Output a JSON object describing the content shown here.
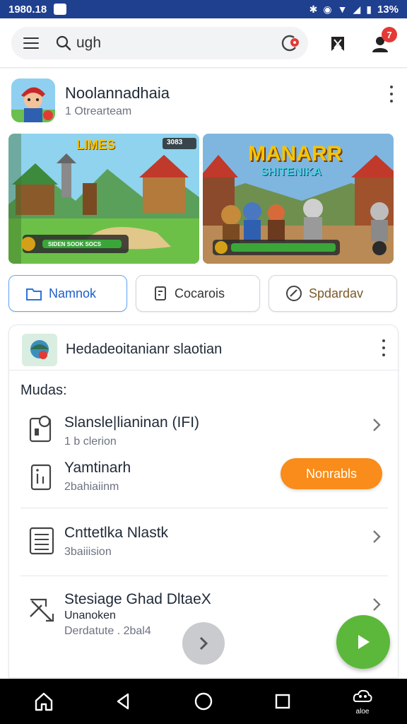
{
  "status_bar": {
    "time": "1980.18",
    "battery": "13%"
  },
  "search": {
    "query": "ugh",
    "notification_count": "7"
  },
  "app": {
    "title": "Noolannadhaia",
    "subtitle": "1 Otrearteam"
  },
  "screenshots": [
    {
      "label": "LIMES",
      "score": "3083",
      "bar_text": "SIDEN SOOK SOCS"
    },
    {
      "label": "MANARR",
      "sub_label": "SHITENIKA"
    }
  ],
  "chips": [
    {
      "label": "Namnok",
      "icon": "bag-icon"
    },
    {
      "label": "Cocarois",
      "icon": "document-icon"
    },
    {
      "label": "Spdardav",
      "icon": "tag-icon"
    }
  ],
  "card": {
    "title": "Hedadeoitanianr slaotian",
    "section": "Mudas:",
    "rows": [
      {
        "title": "Slansle|lianinan (IFI)",
        "sub": "1 b clerion",
        "icon": "phone-settings-icon"
      },
      {
        "title": "Yamtinarh",
        "sub": "2bahiaiinm",
        "icon": "package-icon",
        "button": "Nonrabls"
      },
      {
        "title": "Cnttetlka Nlastk",
        "sub": "3baiiision",
        "icon": "list-icon"
      },
      {
        "title": "Stesiage Ghad DltaeX",
        "sub2": "Unanoken",
        "sub": "Derdatute . 2bal4",
        "icon": "tools-icon"
      }
    ]
  },
  "nav": {
    "recents_label": "aloe"
  },
  "colors": {
    "status_bar": "#1f3f8f",
    "accent_orange": "#f98c1a",
    "play_green": "#5cb83a",
    "chip_active": "#1d5fc9"
  }
}
